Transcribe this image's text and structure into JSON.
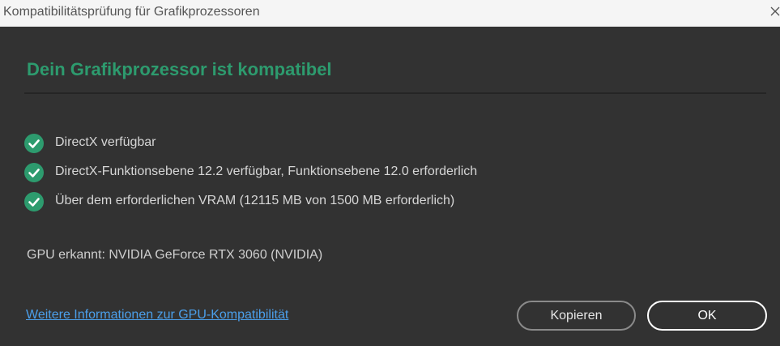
{
  "window": {
    "title": "Kompatibilitätsprüfung für Grafikprozessoren"
  },
  "heading": "Dein Grafikprozessor ist kompatibel",
  "checks": [
    {
      "icon": "check-circle-icon",
      "text": "DirectX verfügbar"
    },
    {
      "icon": "check-circle-icon",
      "text": "DirectX-Funktionsebene 12.2 verfügbar, Funktionsebene 12.0 erforderlich"
    },
    {
      "icon": "check-circle-icon",
      "text": "Über dem erforderlichen VRAM (12115 MB von 1500 MB erforderlich)"
    }
  ],
  "gpu_info": "GPU erkannt: NVIDIA GeForce RTX 3060 (NVIDIA)",
  "link": "Weitere Informationen zur GPU-Kompatibilität",
  "buttons": {
    "copy": "Kopieren",
    "ok": "OK"
  },
  "colors": {
    "accent_green": "#2d9b6e",
    "link_blue": "#4b9fea",
    "background": "#323232"
  }
}
